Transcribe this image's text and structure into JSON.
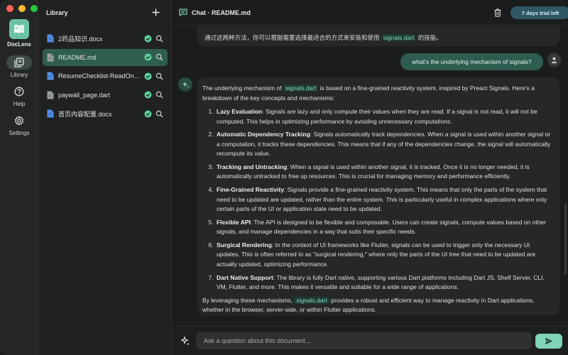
{
  "window": {
    "controls": [
      "close",
      "minimize",
      "maximize"
    ]
  },
  "rail": {
    "app_name": "DocLens",
    "items": [
      {
        "label": "Library",
        "icon": "library-icon",
        "active": true
      },
      {
        "label": "Help",
        "icon": "help-icon",
        "active": false
      },
      {
        "label": "Settings",
        "icon": "gear-icon",
        "active": false
      }
    ]
  },
  "sidebar": {
    "title": "Library",
    "files": [
      {
        "name": "2药品知识.docx",
        "type": "docx",
        "selected": false
      },
      {
        "name": "README.md",
        "type": "md",
        "selected": true
      },
      {
        "name": "ResumeChecklist-ReadOnly.docx",
        "type": "docx",
        "selected": false
      },
      {
        "name": "paywall_page.dart",
        "type": "dart",
        "selected": false
      },
      {
        "name": "首页内容配置.docx",
        "type": "docx",
        "selected": false
      }
    ]
  },
  "header": {
    "title": "Chat · README.md",
    "trial_badge": "7 days trial left"
  },
  "messages": {
    "prev_text_before": "通过这两种方法，你可以根据需要选择最适合的方式来安装和使用 ",
    "prev_code": "signals.dart",
    "prev_text_after": " 的技能。",
    "user_question": "what's the underlying mechanism of signals?",
    "answer": {
      "intro_before": "The underlying mechanism of ",
      "intro_code": "signals.dart",
      "intro_after": " is based on a fine-grained reactivity system, inspired by Preact Signals. Here's a breakdown of the key concepts and mechanisms:",
      "items": [
        {
          "title": "Lazy Evaluation",
          "text": ": Signals are lazy and only compute their values when they are read. If a signal is not read, it will not be computed. This helps in optimizing performance by avoiding unnecessary computations."
        },
        {
          "title": "Automatic Dependency Tracking",
          "text": ": Signals automatically track dependencies. When a signal is used within another signal or a computation, it tracks these dependencies. This means that if any of the dependencies change, the signal will automatically recompute its value."
        },
        {
          "title": "Tracking and Untracking",
          "text": ": When a signal is used within another signal, it is tracked. Once it is no longer needed, it is automatically untracked to free up resources. This is crucial for managing memory and performance efficiently."
        },
        {
          "title": "Fine-Grained Reactivity",
          "text": ": Signals provide a fine-grained reactivity system. This means that only the parts of the system that need to be updated are updated, rather than the entire system. This is particularly useful in complex applications where only certain parts of the UI or application state need to be updated."
        },
        {
          "title": "Flexible API",
          "text": ": The API is designed to be flexible and composable. Users can create signals, compute values based on other signals, and manage dependencies in a way that suits their specific needs."
        },
        {
          "title": "Surgical Rendering",
          "text": ": In the context of UI frameworks like Flutter, signals can be used to trigger only the necessary UI updates. This is often referred to as \"surgical rendering,\" where only the parts of the UI tree that need to be updated are actually updated, optimizing performance."
        },
        {
          "title": "Dart Native Support",
          "text": ": The library is fully Dart native, supporting various Dart platforms including Dart JS, Shelf Server, CLI, VM, Flutter, and more. This makes it versatile and suitable for a wide range of applications."
        }
      ],
      "outro_before": "By leveraging these mechanisms, ",
      "outro_code": "signals.dart",
      "outro_after": " provides a robust and efficient way to manage reactivity in Dart applications, whether in the browser, server-side, or within Flutter applications."
    }
  },
  "input": {
    "placeholder": "Ask a question about this document...",
    "value": ""
  },
  "colors": {
    "accent": "#7fd3b7",
    "selected_row": "#2f5e4f",
    "user_bubble": "#2d5d50",
    "code_text": "#7fdac2",
    "trial_badge": "#2e5864"
  }
}
